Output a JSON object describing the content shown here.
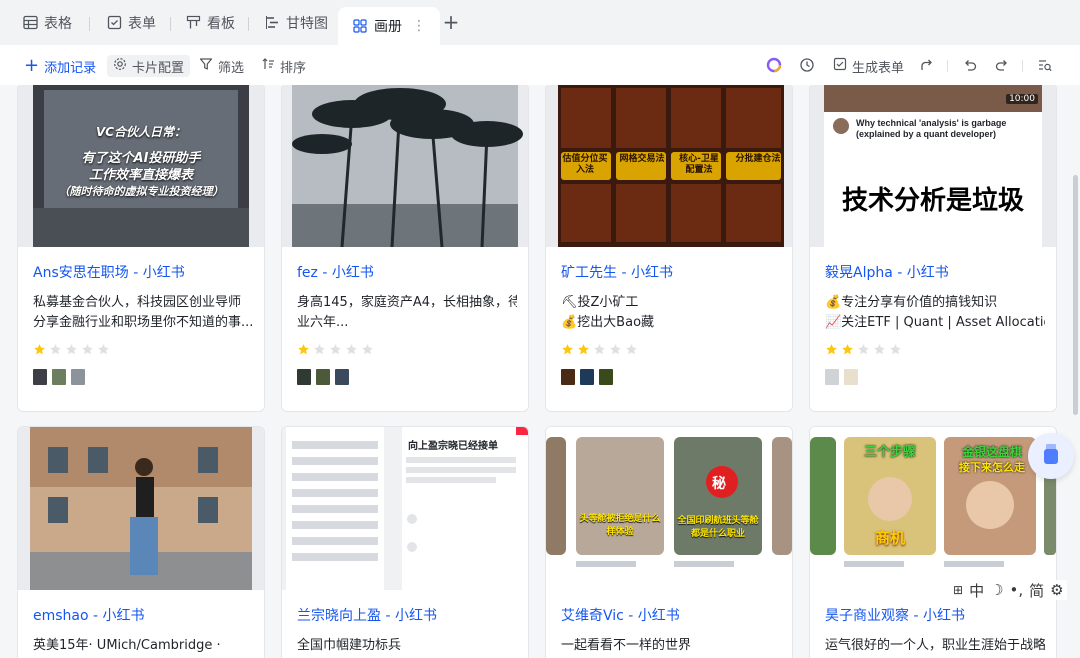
{
  "tabs": [
    {
      "label": "表格",
      "icon": "grid-table-icon"
    },
    {
      "label": "表单",
      "icon": "form-check-icon"
    },
    {
      "label": "看板",
      "icon": "kanban-icon"
    },
    {
      "label": "甘特图",
      "icon": "gantt-icon"
    },
    {
      "label": "画册",
      "icon": "gallery-grid-icon",
      "active": true
    }
  ],
  "toolbar": {
    "add_label": "添加记录",
    "card_config_label": "卡片配置",
    "filter_label": "筛选",
    "sort_label": "排序",
    "generate_form_label": "生成表单"
  },
  "cards": [
    {
      "title": "Ans安思在职场 - 小红书",
      "desc": [
        "私募基金合伙人，科技园区创业导师",
        "分享金融行业和职场里你不知道的事..."
      ],
      "stars": 1,
      "cover_text": [
        "VC合伙人日常：",
        "有了这个AI投研助手",
        "工作效率直接爆表",
        "（随时待命的虚拟专业投资经理）"
      ]
    },
    {
      "title": "fez - 小红书",
      "desc": [
        "身高145，家庭资产A4，长相抽象，待",
        "业六年..."
      ],
      "stars": 1,
      "cover_text": []
    },
    {
      "title": "矿工先生 - 小红书",
      "desc": [
        "⛏投Z小矿工",
        "💰挖出大Bao藏"
      ],
      "stars": 2,
      "cover_text": [
        "估值分位买入法",
        "网格交易法",
        "核心-卫星配置法",
        "分批建仓法"
      ]
    },
    {
      "title": "毅晃Alpha - 小红书",
      "desc": [
        "💰专注分享有价值的搞钱知识",
        "📈关注ETF | Quant | Asset Allocatio..."
      ],
      "stars": 2,
      "cover_text": [
        "Why technical 'analysis' is garbage",
        "(explained by a quant developer)",
        "技术分析是垃圾",
        "10:00"
      ]
    },
    {
      "title": "emshao - 小红书",
      "desc": [
        "英美15年· UMich/Cambridge ·"
      ],
      "stars": 0,
      "cover_text": []
    },
    {
      "title": "兰宗晓向上盈 - 小红书",
      "desc": [
        "全国巾帼建功标兵"
      ],
      "stars": 0,
      "cover_text": [
        "向上盈宗晓已经接单"
      ]
    },
    {
      "title": "艾维奇Vic - 小红书",
      "desc": [
        "一起看看不一样的世界"
      ],
      "stars": 0,
      "cover_text": [
        "头等舱被拒绝是什么样体验",
        "秘",
        "全国印刷航班头等舱都是什么职业"
      ]
    },
    {
      "title": "昊子商业观察 - 小红书",
      "desc": [
        "运气很好的一个人，职业生涯始于战略"
      ],
      "stars": 0,
      "cover_text": [
        "三个步骤",
        "金银这盘棋",
        "接下来怎么走",
        "商机"
      ]
    }
  ],
  "ime": {
    "label": "中",
    "mode": "简"
  },
  "colors": {
    "accent": "#1456f0",
    "star": "#ffc60a",
    "star_empty": "#dee0e3"
  }
}
